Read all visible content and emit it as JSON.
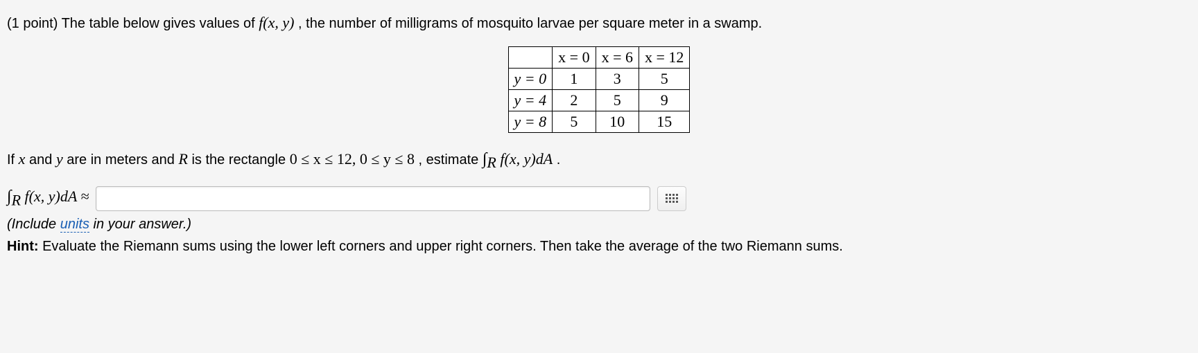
{
  "problem": {
    "points_prefix": "(1 point) ",
    "intro_a": "The table below gives values of ",
    "func": "f(x, y)",
    "intro_b": ", the number of milligrams of mosquito larvae per square meter in a swamp."
  },
  "table": {
    "col_labels": [
      "x = 0",
      "x = 6",
      "x = 12"
    ],
    "rows": [
      {
        "label": "y = 0",
        "cells": [
          "1",
          "3",
          "5"
        ]
      },
      {
        "label": "y = 4",
        "cells": [
          "2",
          "5",
          "9"
        ]
      },
      {
        "label": "y = 8",
        "cells": [
          "5",
          "10",
          "15"
        ]
      }
    ]
  },
  "question": {
    "a": "If ",
    "x": "x",
    "b": " and ",
    "y": "y",
    "c": " are in meters and ",
    "R": "R",
    "d": " is the rectangle ",
    "domain": "0 ≤ x ≤ 12, 0 ≤ y ≤ 8",
    "e": ", estimate ",
    "integral": "∫",
    "sub": "R",
    "integrand": " f(x, y)dA",
    "period": "."
  },
  "answer": {
    "label_integral": "∫",
    "label_sub": "R",
    "label_rest": " f(x, y)dA ≈",
    "value": "",
    "placeholder": ""
  },
  "units_note": {
    "open": "(Include ",
    "link": "units",
    "close": " in your answer.)"
  },
  "hint": {
    "label": "Hint: ",
    "text": "Evaluate the Riemann sums using the lower left corners and upper right corners. Then take the average of the two Riemann sums."
  }
}
